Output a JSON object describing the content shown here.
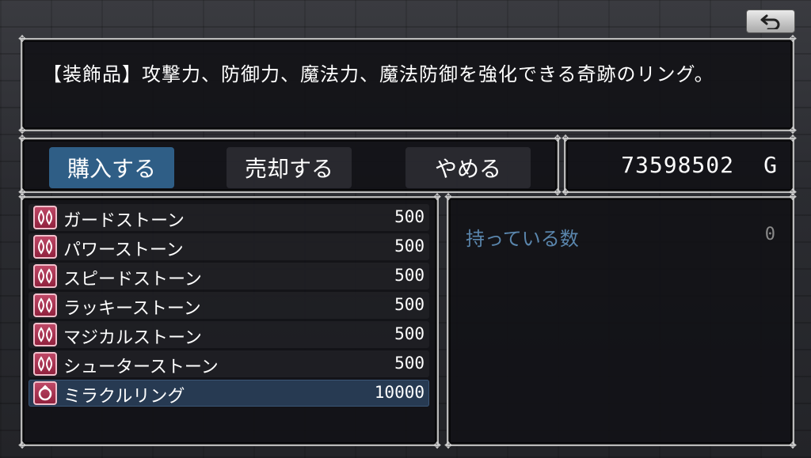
{
  "help": {
    "text": "【装飾品】攻撃力、防御力、魔法力、魔法防御を強化できる奇跡のリング。"
  },
  "commands": [
    {
      "label": "購入する",
      "selected": true
    },
    {
      "label": "売却する",
      "selected": false
    },
    {
      "label": "やめる",
      "selected": false
    }
  ],
  "gold": {
    "amount": "73598502",
    "unit": "G"
  },
  "items": [
    {
      "name": "ガードストーン",
      "price": "500",
      "icon": "stone-icon"
    },
    {
      "name": "パワーストーン",
      "price": "500",
      "icon": "stone-icon"
    },
    {
      "name": "スピードストーン",
      "price": "500",
      "icon": "stone-icon"
    },
    {
      "name": "ラッキーストーン",
      "price": "500",
      "icon": "stone-icon"
    },
    {
      "name": "マジカルストーン",
      "price": "500",
      "icon": "stone-icon"
    },
    {
      "name": "シューターストーン",
      "price": "500",
      "icon": "stone-icon"
    },
    {
      "name": "ミラクルリング",
      "price": "10000",
      "icon": "ring-icon",
      "selected": true
    }
  ],
  "status": {
    "possession_label": "持っている数",
    "possession_value": "0"
  },
  "colors": {
    "selected_command": "#2f5e86",
    "selected_item": "#273a52",
    "label_blue": "#5a86ad",
    "icon_red": "#a83350"
  }
}
